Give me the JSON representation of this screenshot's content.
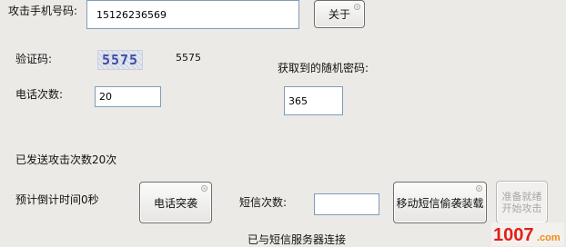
{
  "attack_phone": {
    "label": "攻击手机号码:",
    "value": "15126236569"
  },
  "about_button": "关于",
  "captcha": {
    "label": "验证码:",
    "image_text": "5575",
    "value": "5575"
  },
  "random_password": {
    "label": "获取到的随机密码:",
    "value": "365"
  },
  "call_count": {
    "label": "电话次数:",
    "value": "20"
  },
  "status_sent": "已发送攻击次数20次",
  "countdown": "预计倒计时间0秒",
  "call_attack_button": "电话突袭",
  "sms_count": {
    "label": "短信次数:",
    "value": ""
  },
  "mobile_sms_button": "移动短信偷袭装载",
  "ready_button": {
    "line1": "准备就绪",
    "line2": "开始攻击"
  },
  "server_status": "已与短信服务器连接",
  "watermark": "1007.com",
  "colors": {
    "background": "#eceae6",
    "input_border": "#7f9db9",
    "watermark_red": "#e0201c",
    "watermark_orange": "#f08a12"
  }
}
